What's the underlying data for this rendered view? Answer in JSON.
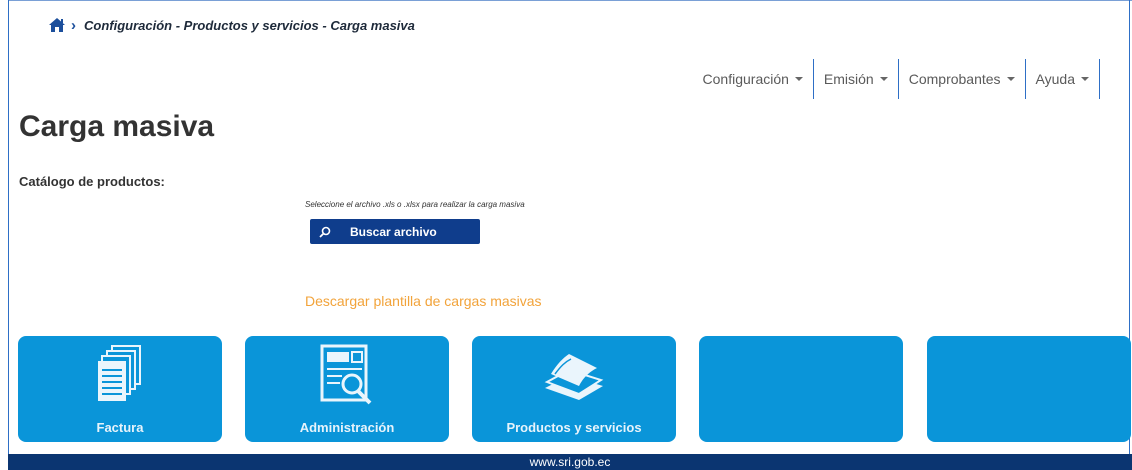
{
  "breadcrumb": {
    "home_icon": "home-icon",
    "separator_icon": "chevron-right-icon",
    "path": "Configuración - Productos y servicios - Carga masiva"
  },
  "nav": {
    "items": [
      {
        "label": "Configuración"
      },
      {
        "label": "Emisión"
      },
      {
        "label": "Comprobantes"
      },
      {
        "label": "Ayuda"
      }
    ]
  },
  "page": {
    "title": "Carga masiva",
    "section_label": "Catálogo de productos:",
    "upload_hint": "Seleccione el archivo .xls o .xlsx para realizar la carga masiva",
    "browse_button": "Buscar archivo",
    "template_link": "Descargar plantilla de cargas masivas"
  },
  "tiles": [
    {
      "label": "Factura",
      "icon": "documents-icon"
    },
    {
      "label": "Administración",
      "icon": "document-search-icon"
    },
    {
      "label": "Productos y servicios",
      "icon": "paper-stack-icon"
    },
    {
      "label": "",
      "icon": ""
    },
    {
      "label": "",
      "icon": ""
    }
  ],
  "footer": {
    "text": "www.sri.gob.ec"
  },
  "colors": {
    "tile_bg": "#0a95d9",
    "button_bg": "#0f3d8c",
    "footer_bg": "#0b3571",
    "link": "#f2a33a",
    "divider": "#2e6fc6"
  }
}
